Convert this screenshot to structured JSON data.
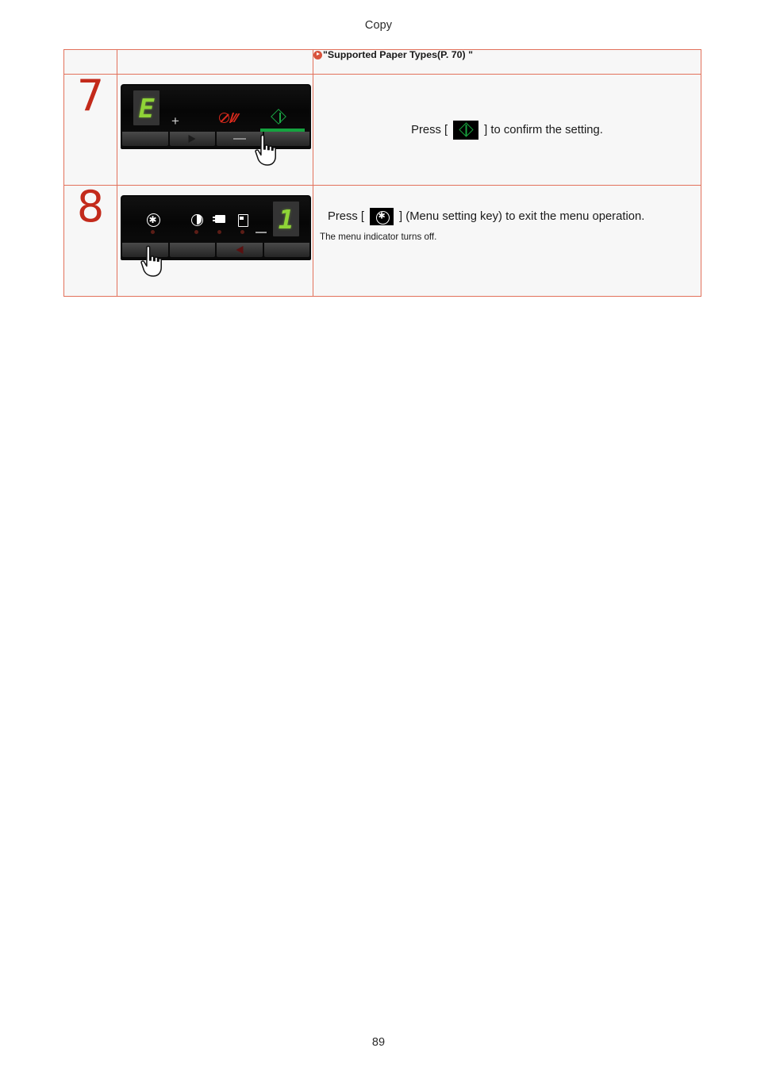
{
  "header": {
    "title": "Copy"
  },
  "footer": {
    "page_number": "89"
  },
  "reference": {
    "bullet_icon": "play-circle-icon",
    "open_quote": "\"",
    "link_text": "Supported Paper Types(P. 70)",
    "close_quote": "\""
  },
  "table": {
    "steps": [
      {
        "number": "7",
        "panel": {
          "display_digit": "E",
          "display_side": "left",
          "plus_label": "+",
          "stop_key_icon": "stop-key-icon",
          "start_key_icon": "start-key-icon",
          "buttons": [
            "",
            "play-right-icon",
            "minus-icon",
            ""
          ],
          "hand_cursor": "hand-pointer-icon"
        },
        "instruction": {
          "prefix": "Press [",
          "key_icon": "start-key-icon",
          "suffix": "] to confirm the setting."
        }
      },
      {
        "number": "8",
        "panel": {
          "display_digit": "1",
          "display_side": "right",
          "minus_label": "—",
          "indicators": [
            {
              "icon": "menu-setting-icon",
              "led": "off"
            },
            {
              "icon": "contrast-icon",
              "led": "off"
            },
            {
              "icon": "paper-settings-icon",
              "led": "off"
            },
            {
              "icon": "id-card-copy-icon",
              "led": "off"
            }
          ],
          "buttons": [
            "",
            "",
            "play-left-icon",
            ""
          ],
          "hand_cursor": "hand-pointer-icon"
        },
        "instruction": {
          "prefix": "Press [",
          "key_icon": "menu-setting-icon",
          "suffix": "] (Menu setting key) to exit the menu operation.",
          "note": "The menu indicator turns off."
        }
      }
    ]
  },
  "colors": {
    "table_border": "#e2715b",
    "step_number": "#c32a1b",
    "reference_bullet": "#d8533c",
    "display_green": "#8fd437",
    "start_green": "#19a544",
    "stop_red": "#d8291c",
    "page_background": "#ffffff",
    "cell_background": "#f7f7f7"
  }
}
